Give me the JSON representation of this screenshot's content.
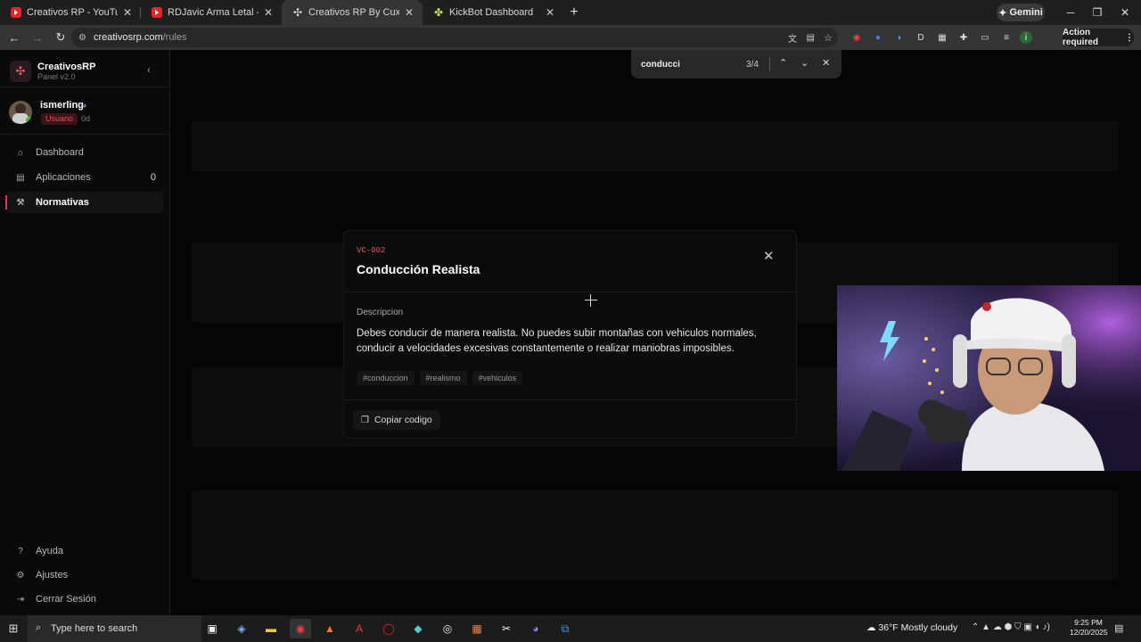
{
  "browser": {
    "tabs": [
      {
        "title": "Creativos RP - YouTube",
        "icon": "youtube-icon"
      },
      {
        "title": "RDJavic Arma Letal - Los Civiles",
        "icon": "youtube-icon"
      },
      {
        "title": "Creativos RP By Cuxial",
        "icon": "creativos-icon"
      },
      {
        "title": "KickBot Dashboard",
        "icon": "kickbot-icon"
      }
    ],
    "gemini_label": "Gemini",
    "url_host": "creativosrp.com",
    "url_path": "/rules",
    "action_required": "Action required",
    "find": {
      "query": "conducci",
      "count": "3/4"
    }
  },
  "sidebar": {
    "brand": "CreativosRP",
    "subtitle": "Panel v2.0",
    "user": {
      "name": "ismerling",
      "role": "Usuario",
      "age": "0d"
    },
    "nav": [
      {
        "label": "Dashboard",
        "icon": "home-icon"
      },
      {
        "label": "Aplicaciones",
        "icon": "document-icon",
        "count": "0"
      },
      {
        "label": "Normativas",
        "icon": "gavel-icon"
      }
    ],
    "footer": [
      {
        "label": "Ayuda",
        "icon": "help-icon"
      },
      {
        "label": "Ajustes",
        "icon": "gear-icon"
      },
      {
        "label": "Cerrar Sesión",
        "icon": "logout-icon"
      }
    ]
  },
  "modal": {
    "code": "VC-002",
    "title": "Conducción Realista",
    "section_label": "Descripcion",
    "description": "Debes conducir de manera realista. No puedes subir montañas con vehiculos normales, conducir a velocidades excesivas constantemente o realizar maniobras imposibles.",
    "tags": [
      "#conduccion",
      "#realismo",
      "#vehiculos"
    ],
    "copy_label": "Copiar codigo"
  },
  "taskbar": {
    "search_placeholder": "Type here to search",
    "weather": "36°F  Mostly cloudy",
    "time": "9:25 PM",
    "date": "12/20/2025"
  },
  "colors": {
    "accent": "#e03a4a",
    "background": "#050505",
    "panel": "#0b0b0b"
  }
}
